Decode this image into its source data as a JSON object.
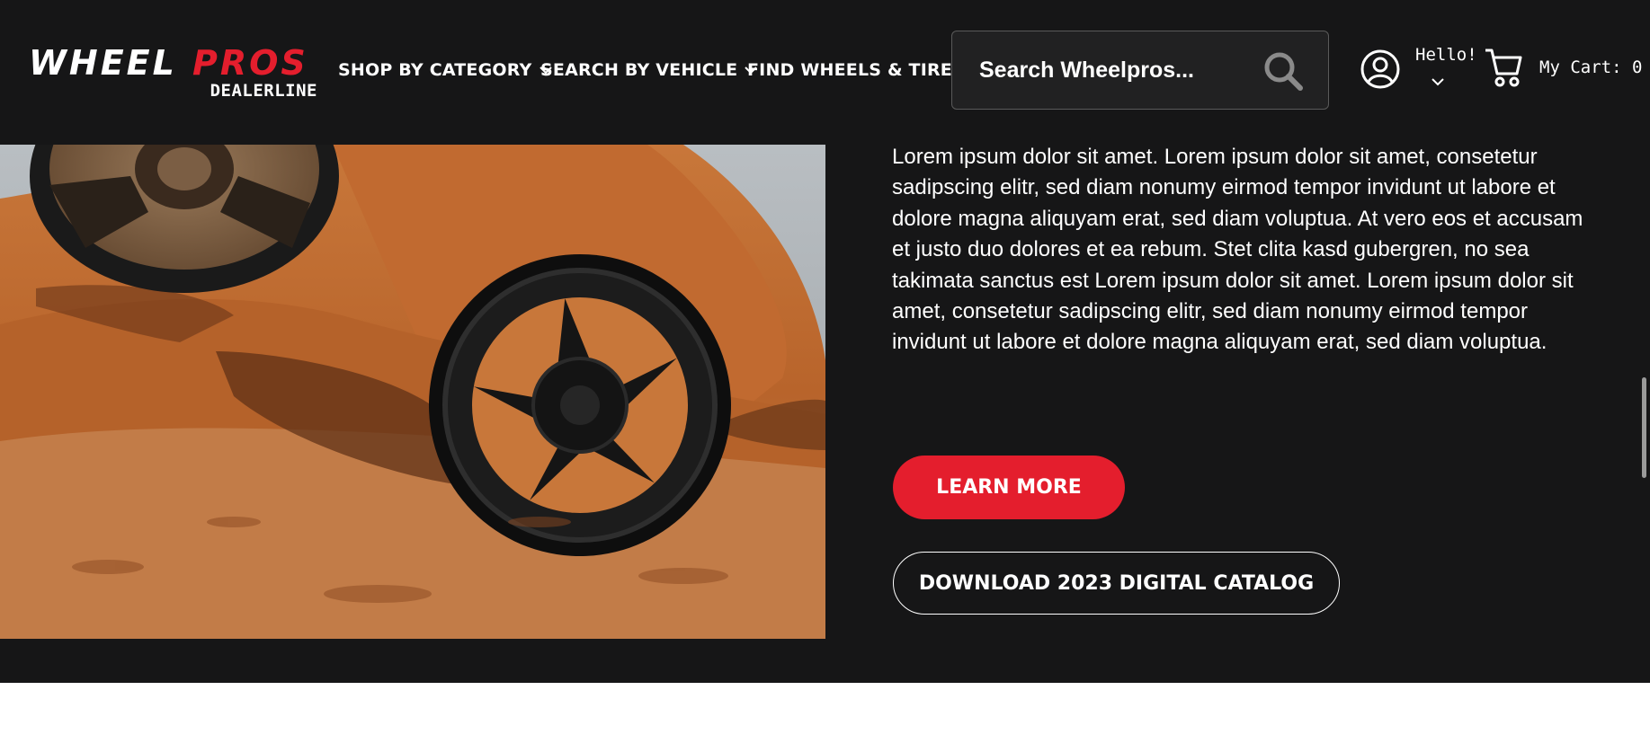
{
  "header": {
    "logo": {
      "brand_first": "WHEEL",
      "brand_second": "PROS",
      "sub": "DEALERLINE",
      "colors": {
        "white": "#ffffff",
        "red": "#e41e2d"
      }
    },
    "nav": [
      {
        "label": "SHOP BY CATEGORY",
        "has_dropdown": true
      },
      {
        "label": "SEARCH BY VEHICLE",
        "has_dropdown": true
      },
      {
        "label": "FIND WHEELS & TIRES",
        "has_dropdown": false
      }
    ],
    "search": {
      "placeholder": "Search Wheelpros...",
      "icon": "search-icon"
    },
    "account": {
      "greeting": "Hello!",
      "icon": "user-circle-icon"
    },
    "cart": {
      "label": "My Cart: 0",
      "icon": "cart-icon"
    }
  },
  "content": {
    "image": {
      "subject": "wheels-on-red-rocks"
    },
    "paragraph": "Lorem ipsum dolor sit amet. Lorem ipsum dolor sit amet, consetetur sadipscing elitr, sed diam nonumy eirmod tempor invidunt ut labore et dolore magna aliquyam erat, sed diam voluptua. At vero eos et accusam et justo duo dolores et ea rebum. Stet clita kasd gubergren, no sea takimata sanctus est Lorem ipsum dolor sit amet. Lorem ipsum dolor sit amet, consetetur sadipscing elitr, sed diam nonumy eirmod tempor invidunt ut labore et dolore magna aliquyam erat, sed diam voluptua.",
    "learn_more": "LEARN MORE",
    "download_catalog": "DOWNLOAD 2023 DIGITAL CATALOG"
  },
  "theme": {
    "background_dark": "#161617",
    "accent_red": "#e41e2d",
    "page_white": "#ffffff"
  }
}
